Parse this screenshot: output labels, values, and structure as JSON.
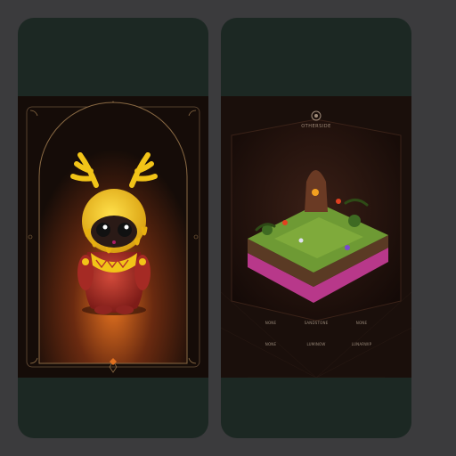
{
  "cards": [
    {
      "id": "character-card",
      "palette": {
        "frame": "#1c2823",
        "art_bg": "#150c08",
        "gold": "#8a6a44",
        "glow": "#d96a1f",
        "yellow": "#f2c418",
        "red": "#b5302a"
      }
    },
    {
      "id": "land-card",
      "brand_name": "OTHERSIDE",
      "brand_tagline": "",
      "stats": [
        {
          "label": "",
          "value": "NONE"
        },
        {
          "label": "",
          "value": "SANDSTONE"
        },
        {
          "label": "",
          "value": "NONE"
        },
        {
          "label": "",
          "value": "NONE"
        },
        {
          "label": "",
          "value": "LUMINOW"
        },
        {
          "label": "",
          "value": "LUNARWIP"
        }
      ],
      "palette": {
        "frame": "#1c2823",
        "art_bg": "#1a0f0b",
        "hex": "#2d1812",
        "grass": "#6e9a34",
        "soil": "#5a3a24",
        "base": "#b8388a"
      }
    }
  ]
}
